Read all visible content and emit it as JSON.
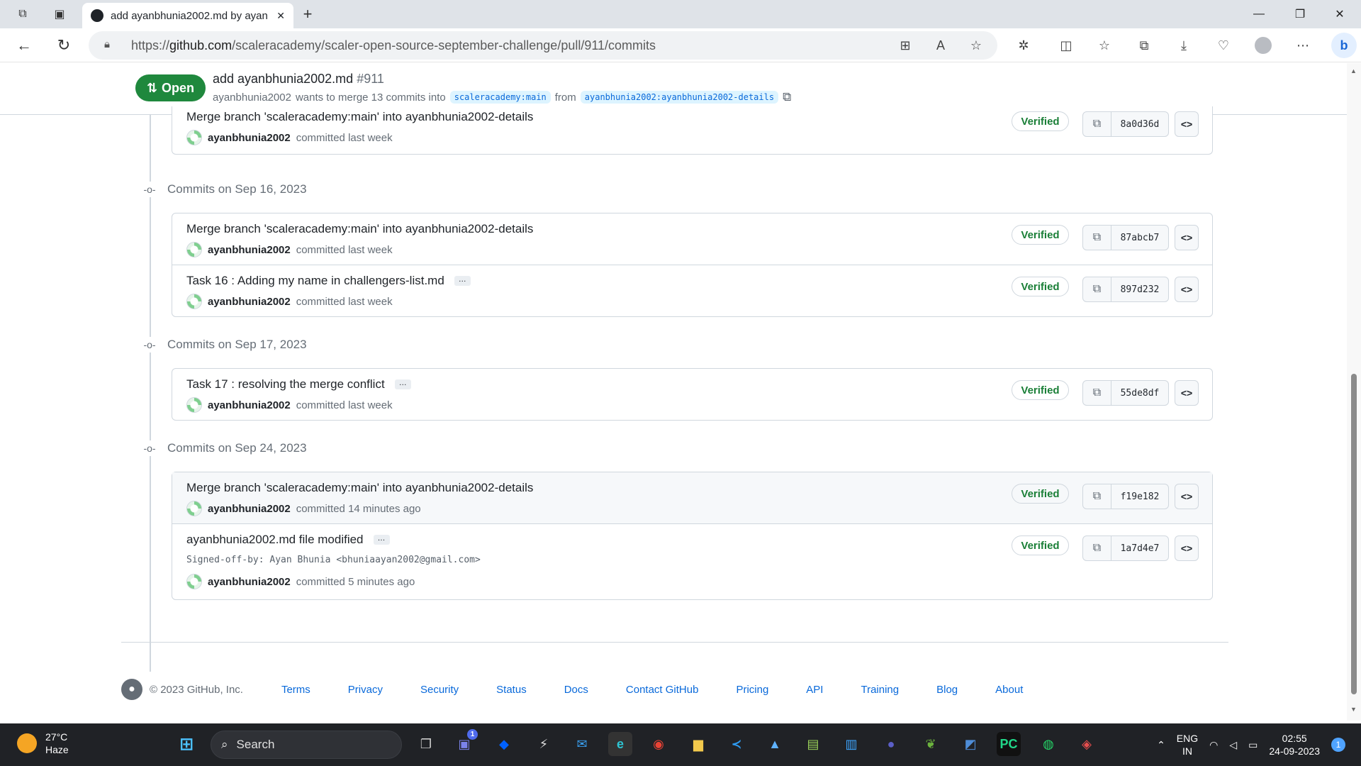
{
  "browser": {
    "tab_title": "add ayanbhunia2002.md by ayan",
    "url_prefix": "https://",
    "url_host": "github.com",
    "url_path": "/scaleracademy/scaler-open-source-september-challenge/pull/911/commits",
    "new_tab_glyph": "+",
    "close_tab_glyph": "✕"
  },
  "pr": {
    "state": "Open",
    "title": "add ayanbhunia2002.md",
    "number": "#911",
    "author": "ayanbhunia2002",
    "merge_text": "wants to merge 13 commits into",
    "base_branch": "scaleracademy:main",
    "from_text": "from",
    "head_branch": "ayanbhunia2002:ayanbhunia2002-details"
  },
  "commit_groups": [
    {
      "date": null,
      "commits": [
        {
          "title": "Merge branch 'scaleracademy:main' into ayanbhunia2002-details",
          "author": "ayanbhunia2002",
          "time": "committed last week",
          "verified": "Verified",
          "sha": "8a0d36d"
        }
      ]
    },
    {
      "date": "Commits on Sep 16, 2023",
      "commits": [
        {
          "title": "Merge branch 'scaleracademy:main' into ayanbhunia2002-details",
          "author": "ayanbhunia2002",
          "time": "committed last week",
          "verified": "Verified",
          "sha": "87abcb7"
        },
        {
          "title": "Task 16 : Adding my name in challengers-list.md",
          "author": "ayanbhunia2002",
          "time": "committed last week",
          "verified": "Verified",
          "sha": "897d232",
          "ellipsis": "…"
        }
      ]
    },
    {
      "date": "Commits on Sep 17, 2023",
      "commits": [
        {
          "title": "Task 17 : resolving the merge conflict",
          "author": "ayanbhunia2002",
          "time": "committed last week",
          "verified": "Verified",
          "sha": "55de8df",
          "ellipsis": "…"
        }
      ]
    },
    {
      "date": "Commits on Sep 24, 2023",
      "commits": [
        {
          "title": "Merge branch 'scaleracademy:main' into ayanbhunia2002-details",
          "author": "ayanbhunia2002",
          "time": "committed 14 minutes ago",
          "verified": "Verified",
          "sha": "f19e182"
        },
        {
          "title": "ayanbhunia2002.md file modified",
          "author": "ayanbhunia2002",
          "time": "committed 5 minutes ago",
          "verified": "Verified",
          "sha": "1a7d4e7",
          "ellipsis": "…",
          "body": "Signed-off-by: Ayan Bhunia <bhuniaayan2002@gmail.com>"
        }
      ]
    }
  ],
  "footer": {
    "copyright": "© 2023 GitHub, Inc.",
    "links": [
      "Terms",
      "Privacy",
      "Security",
      "Status",
      "Docs",
      "Contact GitHub",
      "Pricing",
      "API",
      "Training",
      "Blog",
      "About"
    ]
  },
  "taskbar": {
    "temperature": "27°C",
    "weather": "Haze",
    "search_placeholder": "Search",
    "language": "ENG",
    "region": "IN",
    "time": "02:55",
    "date": "24-09-2023",
    "notification_count": "1",
    "teams_badge": "1"
  },
  "colors": {
    "open_green": "#1f883d",
    "verified_green": "#1a7f37",
    "link_blue": "#0969da"
  }
}
